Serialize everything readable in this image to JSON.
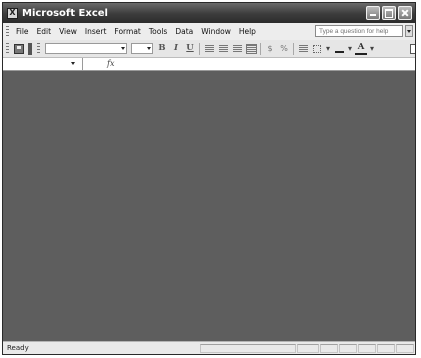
{
  "window": {
    "title": "Microsoft Excel"
  },
  "menu": {
    "items": [
      "File",
      "Edit",
      "View",
      "Insert",
      "Format",
      "Tools",
      "Data",
      "Window",
      "Help"
    ],
    "help_placeholder": "Type a question for help"
  },
  "toolbar": {
    "bold": "B",
    "italic": "I",
    "underline": "U",
    "currency": "$",
    "percent": "%",
    "font_color": "A"
  },
  "formula_bar": {
    "fx_label": "fx"
  },
  "status": {
    "text": "Ready"
  },
  "colors": {
    "workspace": "#5e5e5e",
    "title_bar": "#3c3c3c"
  }
}
